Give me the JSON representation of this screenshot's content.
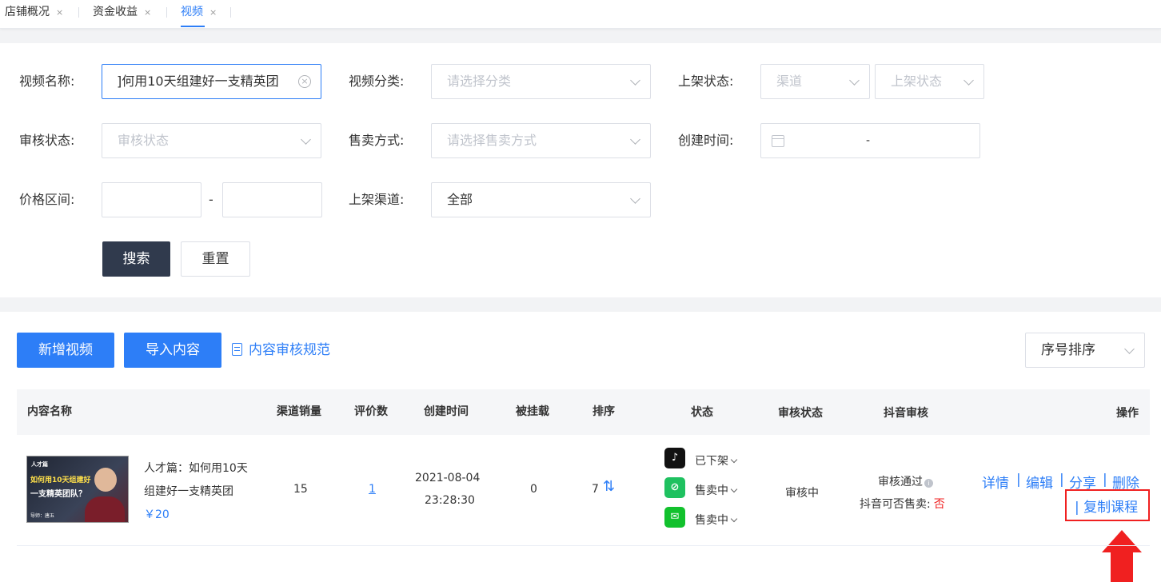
{
  "tabs": [
    {
      "label": "店铺概况",
      "close": "×"
    },
    {
      "label": "资金收益",
      "close": "×"
    },
    {
      "label": "视频",
      "close": "×",
      "active": true
    }
  ],
  "filters": {
    "video_name_label": "视频名称:",
    "video_name_value": "]何用10天组建好一支精英团",
    "video_category_label": "视频分类:",
    "video_category_placeholder": "请选择分类",
    "listing_status_label": "上架状态:",
    "channel_placeholder": "渠道",
    "listing_status_placeholder": "上架状态",
    "review_status_label": "审核状态:",
    "review_status_placeholder": "审核状态",
    "sale_method_label": "售卖方式:",
    "sale_method_placeholder": "请选择售卖方式",
    "created_time_label": "创建时间:",
    "date_range_sep": "-",
    "price_range_label": "价格区间:",
    "price_range_sep": "-",
    "listing_channel_label": "上架渠道:",
    "listing_channel_value": "全部",
    "search_button": "搜索",
    "reset_button": "重置"
  },
  "toolbar": {
    "add_video": "新增视频",
    "import_content": "导入内容",
    "review_rules": "内容审核规范",
    "sort_value": "序号排序"
  },
  "table": {
    "columns": [
      "内容名称",
      "渠道销量",
      "评价数",
      "创建时间",
      "被挂载",
      "排序",
      "状态",
      "审核状态",
      "抖音审核",
      "操作"
    ],
    "rows": [
      {
        "title_line1": "人才篇：如何用10天",
        "title_line2": "组建好一支精英团",
        "price": "￥20",
        "thumb_texts": [
          "人才篇",
          "如何用10天组建好",
          "一支精英团队？",
          "导师：唐五"
        ],
        "channel_sales": "15",
        "reviews": "1",
        "created_date": "2021-08-04",
        "created_time": "23:28:30",
        "mounted": "0",
        "sort": "7",
        "statuses": [
          {
            "icon": "douyin-icon",
            "text": "已下架"
          },
          {
            "icon": "miniprogram-icon",
            "text": "售卖中"
          },
          {
            "icon": "wechat-icon",
            "text": "售卖中"
          }
        ],
        "review_status": "审核中",
        "douyin_review": "审核通过",
        "douyin_sellable_label": "抖音可否售卖:",
        "douyin_sellable_value": "否",
        "actions": {
          "detail": "详情",
          "edit": "编辑",
          "share": "分享",
          "delete": "删除",
          "copy": "| 复制课程",
          "sep": "|"
        }
      }
    ]
  },
  "colors": {
    "accent": "#2d7ef7",
    "dark_button": "#303a4d",
    "highlight": "#f02020"
  }
}
